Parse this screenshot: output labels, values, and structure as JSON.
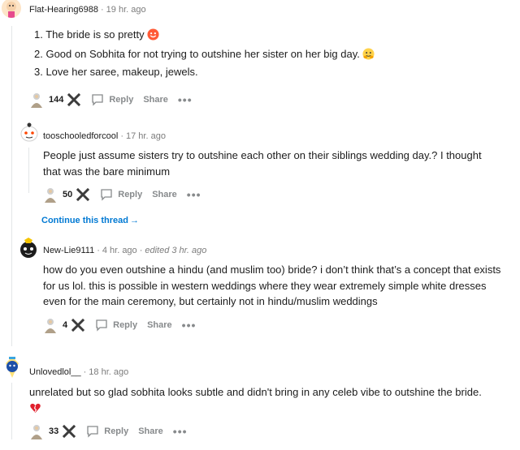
{
  "comments": [
    {
      "username": "Flat-Hearing6988",
      "time": "19 hr. ago",
      "list": [
        "1. The bride is so pretty",
        "2. Good on Sobhita for not trying to outshine her sister on her big day.",
        "3. Love her saree, makeup, jewels."
      ],
      "votes": "144",
      "reply": "Reply",
      "share": "Share",
      "more": "•••"
    },
    {
      "username": "tooschooledforcool",
      "time": "17 hr. ago",
      "body": "People just assume sisters try to outshine each other on their siblings wedding day.? I thought that was the bare minimum",
      "votes": "50",
      "reply": "Reply",
      "share": "Share",
      "more": "•••"
    },
    {
      "username": "New-Lie9111",
      "time": "4 hr. ago",
      "edited": "edited 3 hr. ago",
      "body": "how do you even outshine a hindu (and muslim too) bride? i don’t think that’s a concept that exists for us lol. this is possible in western weddings where they wear extremely simple white dresses even for the main ceremony, but certainly not in hindu/muslim weddings",
      "votes": "4",
      "reply": "Reply",
      "share": "Share",
      "more": "•••"
    },
    {
      "username": "Unlovedlol__",
      "time": "18 hr. ago",
      "body": "unrelated but so glad sobhita looks subtle and didn't bring in any celeb vibe to outshine the bride.",
      "votes": "33",
      "reply": "Reply",
      "share": "Share",
      "more": "•••"
    }
  ],
  "continue_thread": "Continue this thread",
  "colors": {
    "link": "#0079d3",
    "muted": "#7c7c7c",
    "line": "#e3e6e8"
  },
  "icons": [
    "user-avatar-icon",
    "award-icon",
    "downvote-x-icon",
    "reply-bubble-icon",
    "more-dots-icon",
    "smile-emoji-icon",
    "hug-emoji-icon",
    "broken-heart-emoji-icon",
    "arrow-right-icon"
  ]
}
